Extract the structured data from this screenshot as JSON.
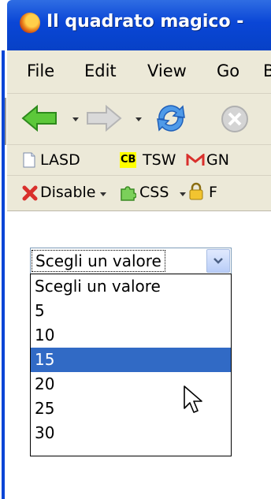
{
  "window": {
    "title": "Il quadrato magico -"
  },
  "menu": [
    "File",
    "Edit",
    "View",
    "Go",
    "B"
  ],
  "bookmarks": {
    "items": [
      "LASD",
      "CB",
      "TSW",
      "GN"
    ]
  },
  "devbar": {
    "disable_label": "Disable",
    "css_label": "CSS",
    "f_label": "F"
  },
  "select": {
    "current": "Scegli un valore",
    "options": [
      "Scegli un valore",
      "5",
      "10",
      "15",
      "20",
      "25",
      "30"
    ],
    "highlighted_index": 3
  },
  "colors": {
    "titlebar": "#0a46d6",
    "highlight": "#316ac5",
    "chrome": "#ece9d8"
  }
}
